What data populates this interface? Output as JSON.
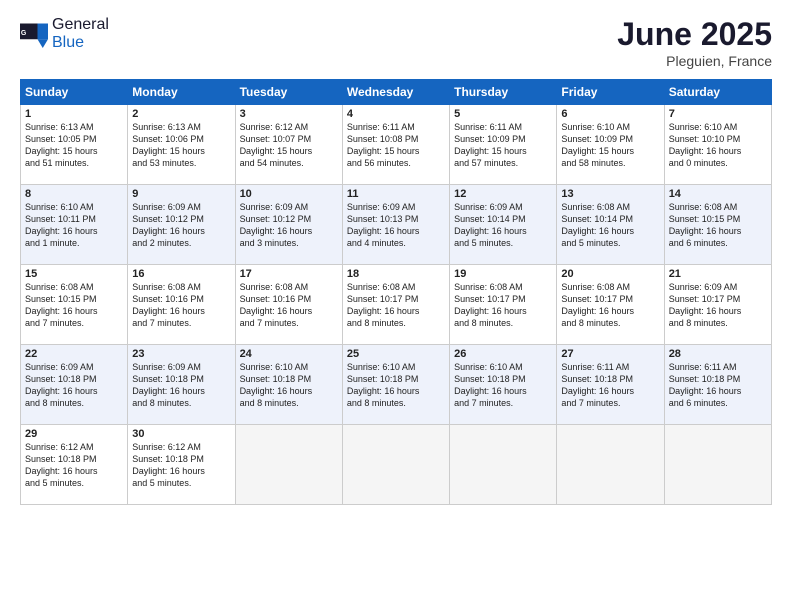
{
  "header": {
    "logo_general": "General",
    "logo_blue": "Blue",
    "month_title": "June 2025",
    "location": "Pleguien, France"
  },
  "days_of_week": [
    "Sunday",
    "Monday",
    "Tuesday",
    "Wednesday",
    "Thursday",
    "Friday",
    "Saturday"
  ],
  "weeks": [
    [
      {
        "day": 1,
        "info": "Sunrise: 6:13 AM\nSunset: 10:05 PM\nDaylight: 15 hours\nand 51 minutes."
      },
      {
        "day": 2,
        "info": "Sunrise: 6:13 AM\nSunset: 10:06 PM\nDaylight: 15 hours\nand 53 minutes."
      },
      {
        "day": 3,
        "info": "Sunrise: 6:12 AM\nSunset: 10:07 PM\nDaylight: 15 hours\nand 54 minutes."
      },
      {
        "day": 4,
        "info": "Sunrise: 6:11 AM\nSunset: 10:08 PM\nDaylight: 15 hours\nand 56 minutes."
      },
      {
        "day": 5,
        "info": "Sunrise: 6:11 AM\nSunset: 10:09 PM\nDaylight: 15 hours\nand 57 minutes."
      },
      {
        "day": 6,
        "info": "Sunrise: 6:10 AM\nSunset: 10:09 PM\nDaylight: 15 hours\nand 58 minutes."
      },
      {
        "day": 7,
        "info": "Sunrise: 6:10 AM\nSunset: 10:10 PM\nDaylight: 16 hours\nand 0 minutes."
      }
    ],
    [
      {
        "day": 8,
        "info": "Sunrise: 6:10 AM\nSunset: 10:11 PM\nDaylight: 16 hours\nand 1 minute."
      },
      {
        "day": 9,
        "info": "Sunrise: 6:09 AM\nSunset: 10:12 PM\nDaylight: 16 hours\nand 2 minutes."
      },
      {
        "day": 10,
        "info": "Sunrise: 6:09 AM\nSunset: 10:12 PM\nDaylight: 16 hours\nand 3 minutes."
      },
      {
        "day": 11,
        "info": "Sunrise: 6:09 AM\nSunset: 10:13 PM\nDaylight: 16 hours\nand 4 minutes."
      },
      {
        "day": 12,
        "info": "Sunrise: 6:09 AM\nSunset: 10:14 PM\nDaylight: 16 hours\nand 5 minutes."
      },
      {
        "day": 13,
        "info": "Sunrise: 6:08 AM\nSunset: 10:14 PM\nDaylight: 16 hours\nand 5 minutes."
      },
      {
        "day": 14,
        "info": "Sunrise: 6:08 AM\nSunset: 10:15 PM\nDaylight: 16 hours\nand 6 minutes."
      }
    ],
    [
      {
        "day": 15,
        "info": "Sunrise: 6:08 AM\nSunset: 10:15 PM\nDaylight: 16 hours\nand 7 minutes."
      },
      {
        "day": 16,
        "info": "Sunrise: 6:08 AM\nSunset: 10:16 PM\nDaylight: 16 hours\nand 7 minutes."
      },
      {
        "day": 17,
        "info": "Sunrise: 6:08 AM\nSunset: 10:16 PM\nDaylight: 16 hours\nand 7 minutes."
      },
      {
        "day": 18,
        "info": "Sunrise: 6:08 AM\nSunset: 10:17 PM\nDaylight: 16 hours\nand 8 minutes."
      },
      {
        "day": 19,
        "info": "Sunrise: 6:08 AM\nSunset: 10:17 PM\nDaylight: 16 hours\nand 8 minutes."
      },
      {
        "day": 20,
        "info": "Sunrise: 6:08 AM\nSunset: 10:17 PM\nDaylight: 16 hours\nand 8 minutes."
      },
      {
        "day": 21,
        "info": "Sunrise: 6:09 AM\nSunset: 10:17 PM\nDaylight: 16 hours\nand 8 minutes."
      }
    ],
    [
      {
        "day": 22,
        "info": "Sunrise: 6:09 AM\nSunset: 10:18 PM\nDaylight: 16 hours\nand 8 minutes."
      },
      {
        "day": 23,
        "info": "Sunrise: 6:09 AM\nSunset: 10:18 PM\nDaylight: 16 hours\nand 8 minutes."
      },
      {
        "day": 24,
        "info": "Sunrise: 6:10 AM\nSunset: 10:18 PM\nDaylight: 16 hours\nand 8 minutes."
      },
      {
        "day": 25,
        "info": "Sunrise: 6:10 AM\nSunset: 10:18 PM\nDaylight: 16 hours\nand 8 minutes."
      },
      {
        "day": 26,
        "info": "Sunrise: 6:10 AM\nSunset: 10:18 PM\nDaylight: 16 hours\nand 7 minutes."
      },
      {
        "day": 27,
        "info": "Sunrise: 6:11 AM\nSunset: 10:18 PM\nDaylight: 16 hours\nand 7 minutes."
      },
      {
        "day": 28,
        "info": "Sunrise: 6:11 AM\nSunset: 10:18 PM\nDaylight: 16 hours\nand 6 minutes."
      }
    ],
    [
      {
        "day": 29,
        "info": "Sunrise: 6:12 AM\nSunset: 10:18 PM\nDaylight: 16 hours\nand 5 minutes."
      },
      {
        "day": 30,
        "info": "Sunrise: 6:12 AM\nSunset: 10:18 PM\nDaylight: 16 hours\nand 5 minutes."
      },
      null,
      null,
      null,
      null,
      null
    ]
  ]
}
